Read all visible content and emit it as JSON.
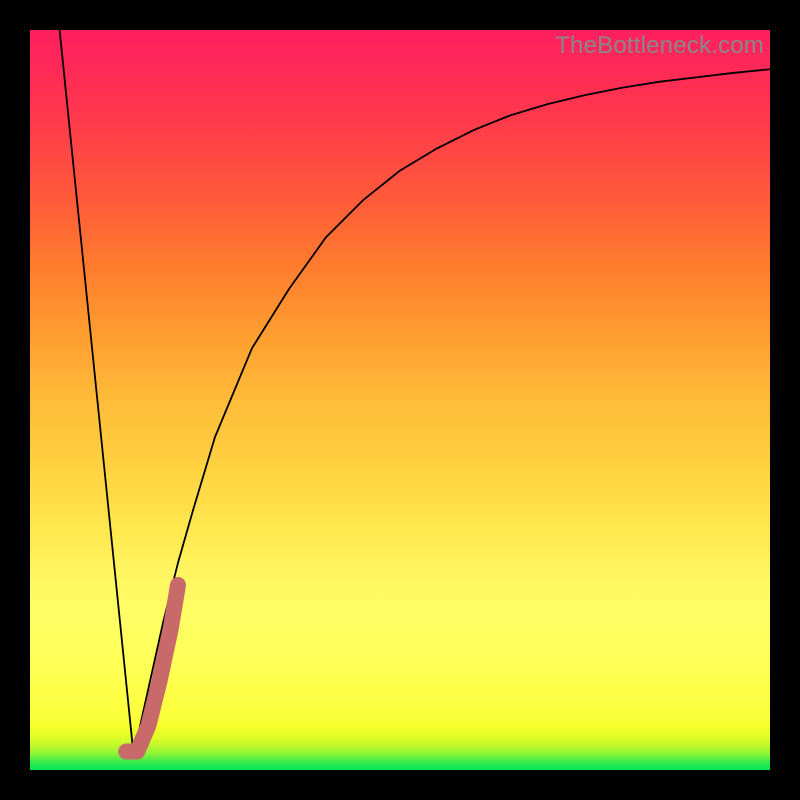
{
  "watermark": "TheBottleneck.com",
  "chart_data": {
    "type": "line",
    "title": "",
    "xlabel": "",
    "ylabel": "",
    "xlim": [
      0,
      100
    ],
    "ylim": [
      0,
      100
    ],
    "grid": false,
    "legend": false,
    "series": [
      {
        "name": "main-curve-left",
        "x": [
          4,
          14
        ],
        "values": [
          100,
          2
        ],
        "stroke": "#000000",
        "width": 1.8
      },
      {
        "name": "main-curve-right",
        "x": [
          14,
          16,
          18,
          20,
          22,
          25,
          30,
          35,
          40,
          45,
          50,
          55,
          60,
          65,
          70,
          75,
          80,
          85,
          90,
          95,
          100
        ],
        "values": [
          2,
          11,
          20,
          28,
          35,
          45,
          57,
          65,
          72,
          77,
          81,
          84,
          86.5,
          88.5,
          90,
          91.2,
          92.2,
          93,
          93.6,
          94.2,
          94.7
        ],
        "stroke": "#000000",
        "width": 1.8
      },
      {
        "name": "highlight-segment",
        "x": [
          13,
          14.5,
          16,
          17.5,
          19,
          20
        ],
        "values": [
          2.5,
          2.5,
          6,
          12,
          19,
          25
        ],
        "stroke": "#c96a6a",
        "width": 16
      }
    ]
  }
}
